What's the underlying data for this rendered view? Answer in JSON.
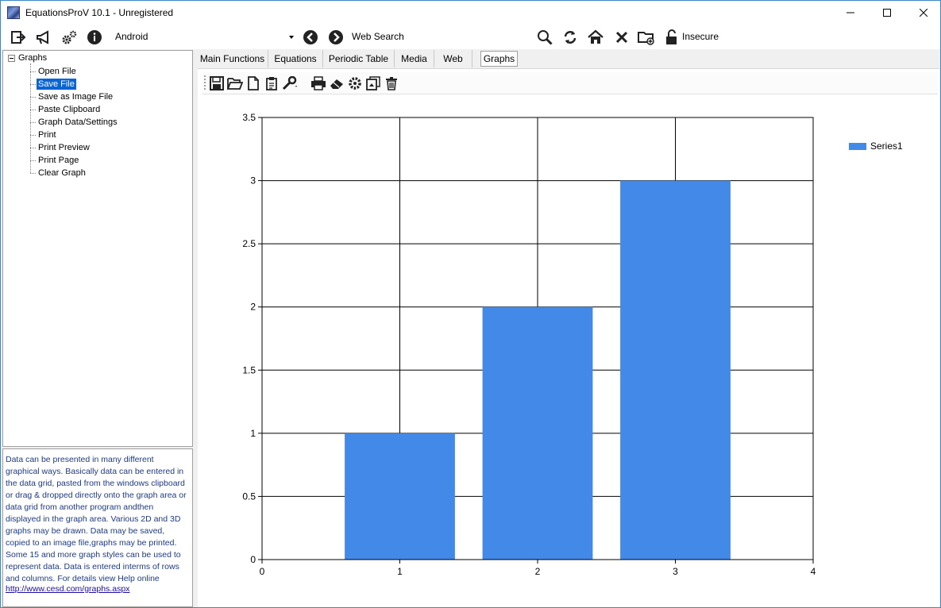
{
  "window": {
    "title": "EquationsProV 10.1 - Unregistered"
  },
  "toolbar": {
    "platform_label": "Android",
    "web_search_label": "Web Search",
    "security_label": "Insecure"
  },
  "tree": {
    "root_label": "Graphs",
    "items": [
      {
        "label": "Open File",
        "selected": false
      },
      {
        "label": "Save File",
        "selected": true
      },
      {
        "label": "Save as Image File",
        "selected": false
      },
      {
        "label": "Paste Clipboard",
        "selected": false
      },
      {
        "label": "Graph Data/Settings",
        "selected": false
      },
      {
        "label": "Print",
        "selected": false
      },
      {
        "label": "Print Preview",
        "selected": false
      },
      {
        "label": "Print Page",
        "selected": false
      },
      {
        "label": "Clear Graph",
        "selected": false
      }
    ]
  },
  "help": {
    "text": "Data can be presented in many different graphical ways. Basically data can be entered in the data grid, pasted from the windows clipboard or drag & dropped directly onto the graph area or data grid from another program andthen displayed in the graph area. Various 2D and 3D graphs may be drawn. Data may be saved, copied to an image file,graphs may be printed. Some 15 and more graph styles can be used to represent data. Data is entered interms of rows and columns. For details view Help online",
    "link": "http://www.cesd.com/graphs.aspx"
  },
  "tabs": [
    {
      "label": "Main Functions",
      "active": false
    },
    {
      "label": "Equations",
      "active": false
    },
    {
      "label": "Periodic Table",
      "active": false
    },
    {
      "label": "Media",
      "active": false
    },
    {
      "label": "Web",
      "active": false
    },
    {
      "label": "Graphs",
      "active": true
    }
  ],
  "colors": {
    "bar": "#4289e8",
    "selection": "#0a64d8",
    "help_text": "#1e3a8a"
  },
  "chart_data": {
    "type": "bar",
    "x": [
      1,
      2,
      3
    ],
    "series": [
      {
        "name": "Series1",
        "values": [
          1,
          2,
          3
        ]
      }
    ],
    "xlim": [
      0,
      4
    ],
    "ylim": [
      0,
      3.5
    ],
    "xticks": [
      "0",
      "1",
      "2",
      "3",
      "4"
    ],
    "yticks": [
      "0",
      "0.5",
      "1",
      "1.5",
      "2",
      "2.5",
      "3",
      "3.5"
    ],
    "grid": true,
    "legend_position": "top-right",
    "title": "",
    "xlabel": "",
    "ylabel": ""
  }
}
